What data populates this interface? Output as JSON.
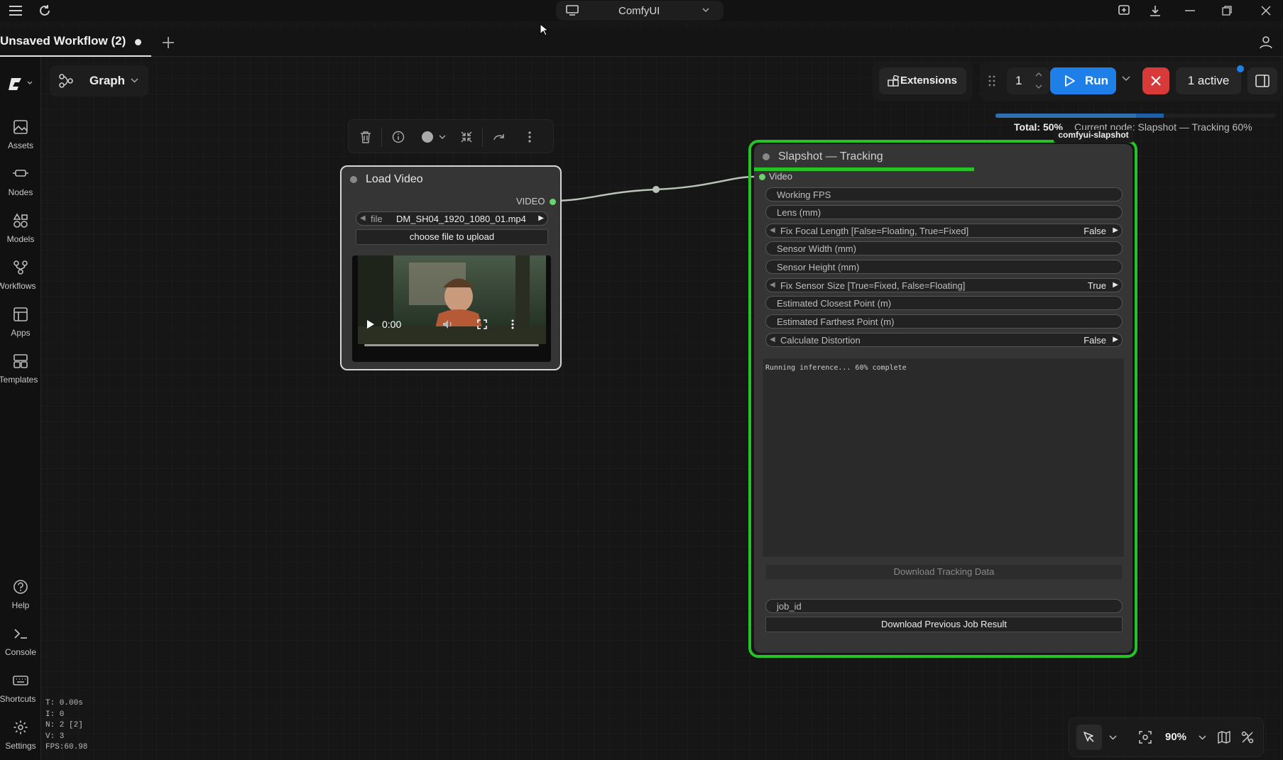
{
  "window": {
    "app_name": "ComfyUI"
  },
  "tabs": [
    {
      "title": "Unsaved Workflow (2)",
      "modified": true
    }
  ],
  "graph_switcher": {
    "label": "Graph"
  },
  "sidebar": {
    "items": [
      {
        "label": "Assets",
        "icon": "image-icon"
      },
      {
        "label": "Nodes",
        "icon": "nodes-icon"
      },
      {
        "label": "Models",
        "icon": "models-icon"
      },
      {
        "label": "Workflows",
        "icon": "workflows-icon"
      },
      {
        "label": "Apps",
        "icon": "apps-icon"
      },
      {
        "label": "Templates",
        "icon": "templates-icon"
      }
    ],
    "bottom_items": [
      {
        "label": "Help",
        "icon": "help-icon"
      },
      {
        "label": "Console",
        "icon": "console-icon"
      },
      {
        "label": "Shortcuts",
        "icon": "keyboard-icon"
      },
      {
        "label": "Settings",
        "icon": "gear-icon"
      }
    ]
  },
  "toolbar": {
    "extensions_label": "Extensions",
    "batch_count": "1",
    "run_label": "Run",
    "active_label": "1 active"
  },
  "progress": {
    "total_label": "Total: 50%",
    "total_fraction": 0.5,
    "node_label": "Current node: Slapshot — Tracking 60%",
    "node_fraction": 0.6
  },
  "nodes": {
    "load_video": {
      "title": "Load Video",
      "output_label": "VIDEO",
      "file_label": "file",
      "file_value": "DM_SH04_1920_1080_01.mp4",
      "upload_label": "choose file to upload",
      "video_time": "0:00"
    },
    "slapshot": {
      "title": "Slapshot — Tracking",
      "tag": "comfyui-slapshot",
      "progress_fraction": 0.6,
      "input_label": "Video",
      "widgets": [
        {
          "label": "Working FPS",
          "value": ""
        },
        {
          "label": "Lens (mm)",
          "value": ""
        },
        {
          "label": "Fix Focal Length  [False=Floating, True=Fixed]",
          "value": "False",
          "combo": true
        },
        {
          "label": "Sensor Width (mm)",
          "value": ""
        },
        {
          "label": "Sensor Height (mm)",
          "value": ""
        },
        {
          "label": "Fix Sensor Size  [True=Fixed, False=Floating]",
          "value": "True",
          "combo": true
        },
        {
          "label": "Estimated Closest Point (m)",
          "value": ""
        },
        {
          "label": "Estimated Farthest Point (m)",
          "value": ""
        },
        {
          "label": "Calculate Distortion",
          "value": "False",
          "combo": true
        }
      ],
      "console_text": "Running inference... 60% complete",
      "download_tracking_label": "Download Tracking Data",
      "job_id_label": "job_id",
      "download_previous_label": "Download Previous Job Result"
    }
  },
  "stats": [
    "T: 0.00s",
    "I: 0",
    "N: 2 [2]",
    "V: 3",
    "FPS:60.98"
  ],
  "canvas_controls": {
    "zoom_label": "90%"
  },
  "colors": {
    "accent": "#1e7fe8",
    "running_outline": "#27c225",
    "cancel": "#d83a3a"
  }
}
